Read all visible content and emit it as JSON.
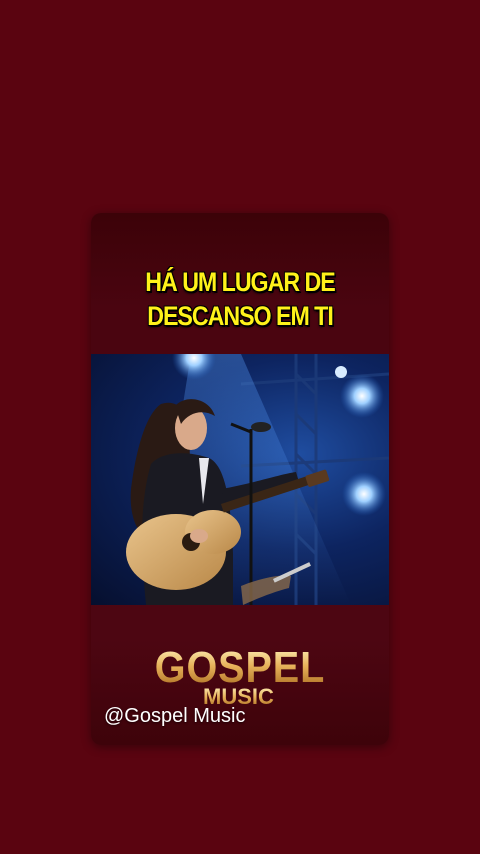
{
  "post": {
    "caption_line1": "HÁ UM LUGAR DE",
    "caption_line2": "DESCANSO EM TI",
    "video_subject": "woman singing with acoustic guitar on stage",
    "logo_main": "GOSPEL",
    "logo_sub": "MUSIC",
    "handle": "@Gospel Music"
  },
  "colors": {
    "background": "#5a0410",
    "caption": "#fff21a",
    "logo_gold": "#e6b35a"
  }
}
